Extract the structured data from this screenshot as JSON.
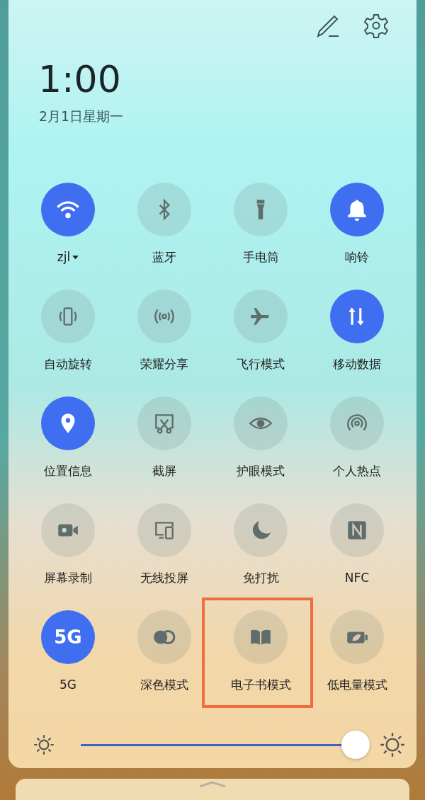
{
  "header": {
    "time": "1:00",
    "date": "2月1日星期一"
  },
  "tiles": [
    {
      "label": "zjl",
      "kind": "icon",
      "on": true,
      "dropdown": true
    },
    {
      "label": "蓝牙",
      "kind": "icon",
      "on": false
    },
    {
      "label": "手电筒",
      "kind": "icon",
      "on": false
    },
    {
      "label": "响铃",
      "kind": "icon",
      "on": true
    },
    {
      "label": "自动旋转",
      "kind": "icon",
      "on": false
    },
    {
      "label": "荣耀分享",
      "kind": "icon",
      "on": false
    },
    {
      "label": "飞行模式",
      "kind": "icon",
      "on": false
    },
    {
      "label": "移动数据",
      "kind": "icon",
      "on": true
    },
    {
      "label": "位置信息",
      "kind": "icon",
      "on": true
    },
    {
      "label": "截屏",
      "kind": "icon",
      "on": false
    },
    {
      "label": "护眼模式",
      "kind": "icon",
      "on": false
    },
    {
      "label": "个人热点",
      "kind": "icon",
      "on": false
    },
    {
      "label": "屏幕录制",
      "kind": "icon",
      "on": false
    },
    {
      "label": "无线投屏",
      "kind": "icon",
      "on": false
    },
    {
      "label": "免打扰",
      "kind": "icon",
      "on": false
    },
    {
      "label": "NFC",
      "kind": "icon",
      "on": false
    },
    {
      "label": "5G",
      "kind": "glyph",
      "glyph": "5G",
      "on": true
    },
    {
      "label": "深色模式",
      "kind": "icon",
      "on": false
    },
    {
      "label": "电子书模式",
      "kind": "icon",
      "on": false,
      "highlighted": true
    },
    {
      "label": "低电量模式",
      "kind": "icon",
      "on": false
    }
  ],
  "brightness": {
    "level": 1
  }
}
